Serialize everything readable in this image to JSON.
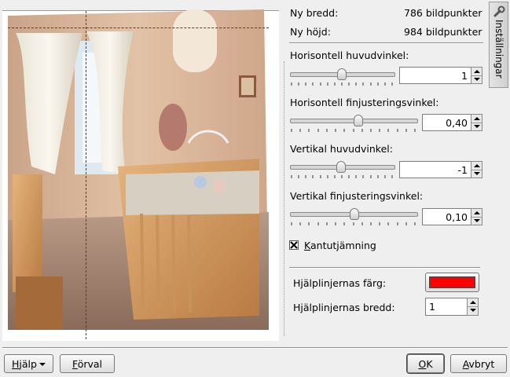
{
  "info": {
    "width_label": "Ny bredd:",
    "width_value": "786 bildpunkter",
    "height_label": "Ny höjd:",
    "height_value": "984 bildpunkter"
  },
  "controls": [
    {
      "label": "Horisontell huvudvinkel:",
      "value": "1",
      "fraction": 0.5
    },
    {
      "label": "Horisontell finjusteringsvinkel:",
      "value": "0,40",
      "fraction": 0.54
    },
    {
      "label": "Vertikal huvudvinkel:",
      "value": "-1",
      "fraction": 0.49
    },
    {
      "label": "Vertikal finjusteringsvinkel:",
      "value": "0,10",
      "fraction": 0.51
    }
  ],
  "antialias": {
    "label_rest": "antutjämning",
    "label_first": "K",
    "checked": true
  },
  "guide": {
    "color_label": "Hjälplinjernas färg:",
    "color_value": "#ff0000",
    "width_label": "Hjälplinjernas bredd:",
    "width_value": "1"
  },
  "side_tab": {
    "label": "Inställningar"
  },
  "buttons": {
    "help_first": "H",
    "help_rest": "jälp",
    "defaults_first": "F",
    "defaults_rest": "örval",
    "ok_first": "O",
    "ok_rest": "K",
    "cancel_first": "A",
    "cancel_rest": "vbryt"
  }
}
